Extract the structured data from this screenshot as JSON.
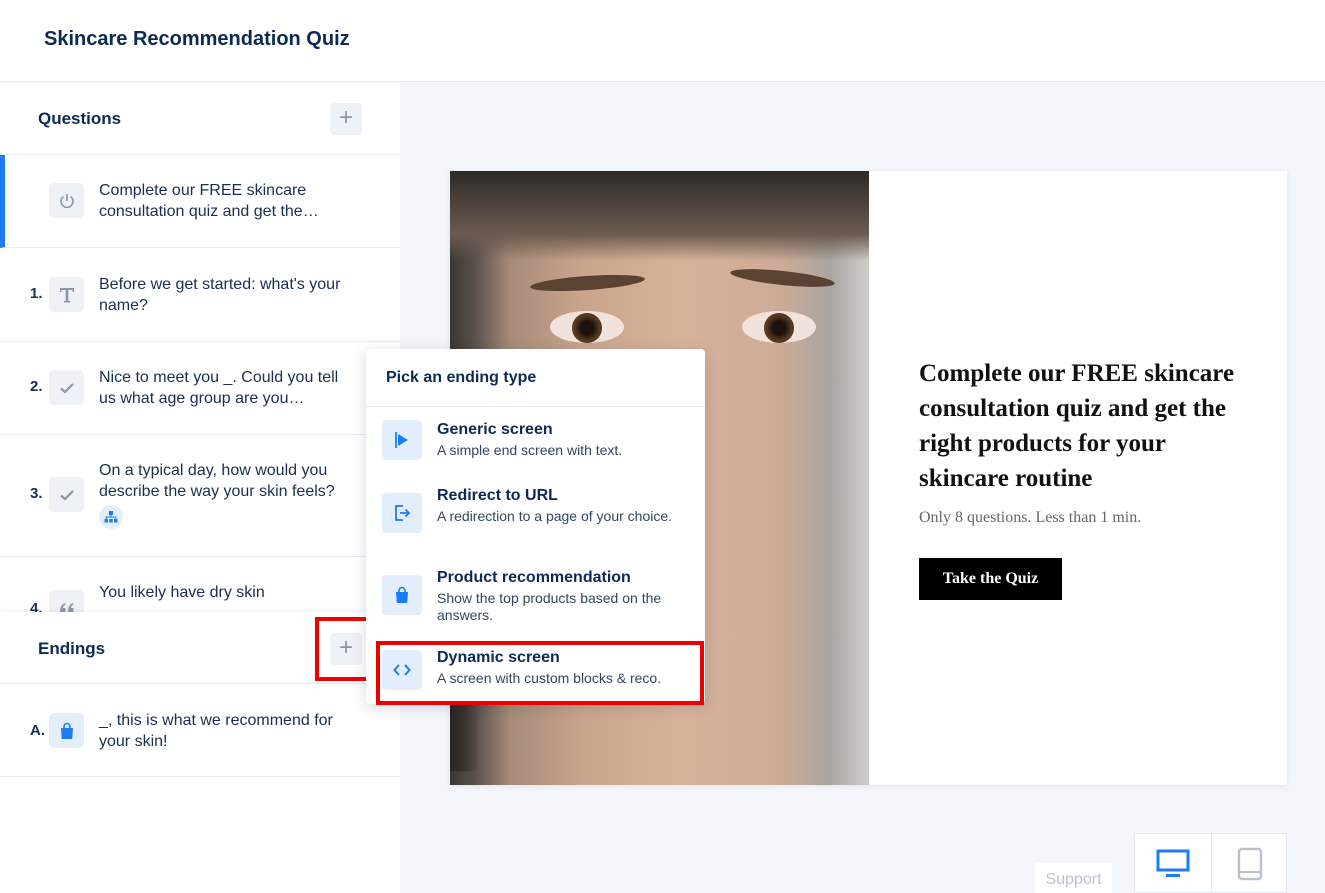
{
  "app": {
    "title": "Skincare Recommendation Quiz"
  },
  "sidebar": {
    "questions_label": "Questions",
    "endings_label": "Endings",
    "add_glyph": "+",
    "questions": [
      {
        "num": "",
        "text": "Complete our FREE skincare consultation quiz and get the…",
        "icon": "power-icon"
      },
      {
        "num": "1.",
        "text": "Before we get started: what's your name?",
        "icon": "text-icon"
      },
      {
        "num": "2.",
        "text": "Nice to meet you _. Could you tell us what age group are you…",
        "icon": "check-icon"
      },
      {
        "num": "3.",
        "text": "On a typical day, how would you describe the way your skin feels?",
        "icon": "check-icon"
      },
      {
        "num": "4.",
        "text": "You likely have dry skin",
        "icon": "quote-icon"
      }
    ],
    "endings": [
      {
        "num": "A.",
        "text": "_, this is what we recommend for your skin!",
        "icon": "shopping-bag-icon"
      }
    ]
  },
  "preview": {
    "title": "Complete our FREE skincare consultation quiz and get the right products for your skincare routine",
    "subtitle": "Only 8 questions. Less than 1 min.",
    "button": "Take the Quiz"
  },
  "dropdown": {
    "heading": "Pick an ending type",
    "options": [
      {
        "title": "Generic screen",
        "desc": "A simple end screen with text.",
        "icon": "flag-icon"
      },
      {
        "title": "Redirect to URL",
        "desc": "A redirection to a page of your choice.",
        "icon": "redirect-icon"
      },
      {
        "title": "Product recommendation",
        "desc": "Show the top products based on the answers.",
        "icon": "shopping-bag-icon"
      },
      {
        "title": "Dynamic screen",
        "desc": "A screen with custom blocks & reco.",
        "icon": "code-icon"
      }
    ]
  },
  "footer": {
    "support": "Support"
  },
  "colors": {
    "accent": "#1c7cf4",
    "navy": "#0d2a54",
    "highlight": "#e00000"
  }
}
